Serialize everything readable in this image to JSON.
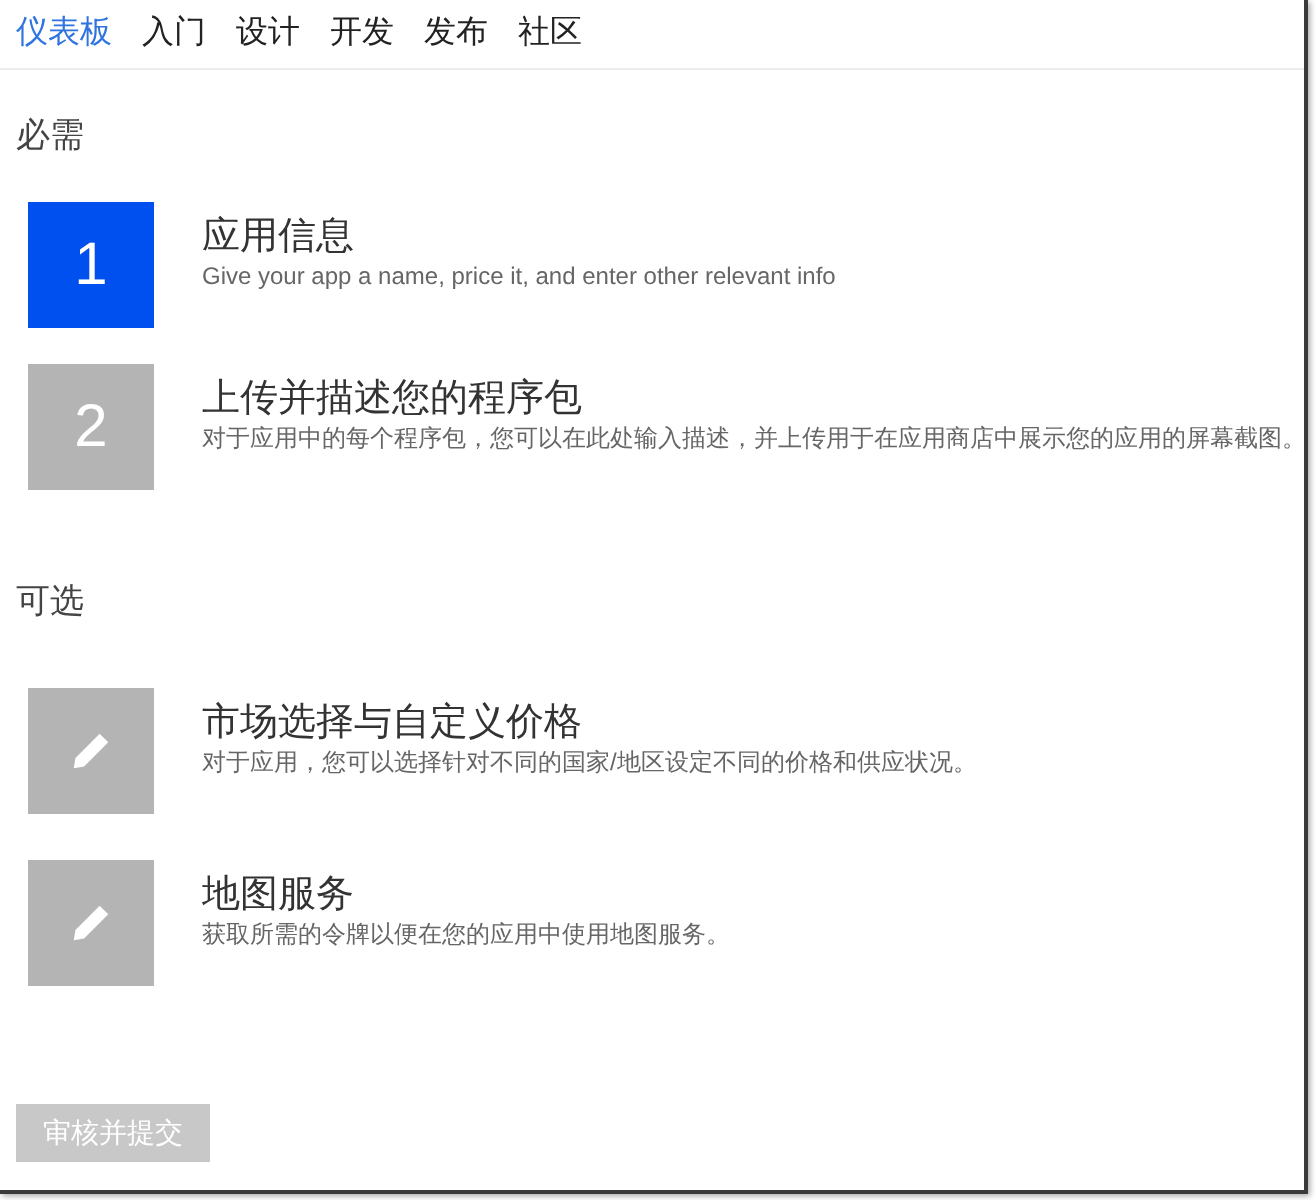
{
  "nav": {
    "items": [
      {
        "label": "仪表板",
        "selected": true
      },
      {
        "label": "入门",
        "selected": false
      },
      {
        "label": "设计",
        "selected": false
      },
      {
        "label": "开发",
        "selected": false
      },
      {
        "label": "发布",
        "selected": false
      },
      {
        "label": "社区",
        "selected": false
      }
    ]
  },
  "sections": [
    {
      "heading": "必需",
      "steps": [
        {
          "kind": "number",
          "marker": "1",
          "active": true,
          "title": "应用信息",
          "description": "Give your app a name, price it, and enter other relevant info"
        },
        {
          "kind": "number",
          "marker": "2",
          "active": false,
          "title": "上传并描述您的程序包",
          "description": "对于应用中的每个程序包，您可以在此处输入描述，并上传用于在应用商店中展示您的应用的屏幕截图。"
        }
      ]
    },
    {
      "heading": "可选",
      "steps": [
        {
          "kind": "edit",
          "active": false,
          "title": "市场选择与自定义价格",
          "description": "对于应用，您可以选择针对不同的国家/地区设定不同的价格和供应状况。"
        },
        {
          "kind": "edit",
          "active": false,
          "title": "地图服务",
          "description": "获取所需的令牌以便在您的应用中使用地图服务。"
        }
      ]
    }
  ],
  "submit_button": {
    "label": "审核并提交",
    "disabled": true
  }
}
